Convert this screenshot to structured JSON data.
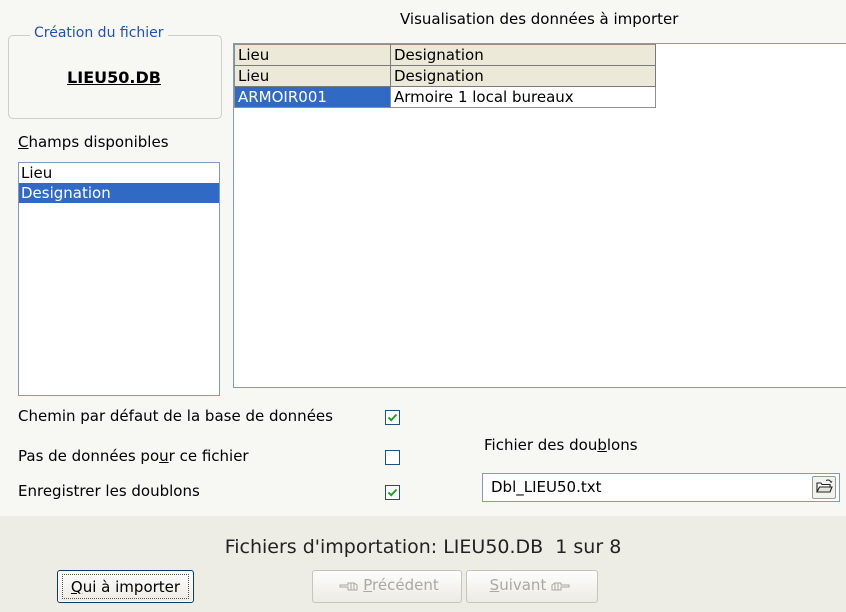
{
  "file_group": {
    "legend": "Création du fichier",
    "file_name": "LIEU50.DB"
  },
  "preview_title": "Visualisation des données à importer",
  "fields": {
    "label_prefix": "C",
    "label_rest": "hamps disponibles",
    "items": [
      {
        "label": "Lieu",
        "selected": false
      },
      {
        "label": "Designation",
        "selected": true
      }
    ]
  },
  "grid": {
    "header": [
      "Lieu",
      "Designation"
    ],
    "mapping_row": [
      "Lieu",
      "Designation"
    ],
    "rows": [
      [
        "ARMOIR001",
        "Armoire 1 local bureaux"
      ]
    ]
  },
  "options": {
    "default_path": {
      "label": "Chemin par défaut de la base de données",
      "checked": true
    },
    "no_data": {
      "label_a": "Pas de données po",
      "label_u": "u",
      "label_b": "r ce fichier",
      "checked": false
    },
    "save_duplicates": {
      "label": "Enregistrer les doublons",
      "checked": true
    }
  },
  "duplicates_file": {
    "label_a": "Fichier des dou",
    "label_u": "b",
    "label_b": "lons",
    "value": "Dbl_LIEU50.txt"
  },
  "status": "Fichiers d'importation: LIEU50.DB  1 sur 8",
  "buttons": {
    "import_u": "Q",
    "import_rest": "ui à importer",
    "prev_u": "P",
    "prev_rest": "récédent",
    "next_u": "S",
    "next_rest": "uivant"
  },
  "icons": {
    "browse": "folder-open-icon",
    "prev": "hand-pointing-left-icon",
    "next": "hand-pointing-right-icon",
    "check": "checkmark-icon"
  },
  "colors": {
    "selection": "#316ac5",
    "legend_text": "#1e52b7",
    "checkmark": "#21a121"
  }
}
